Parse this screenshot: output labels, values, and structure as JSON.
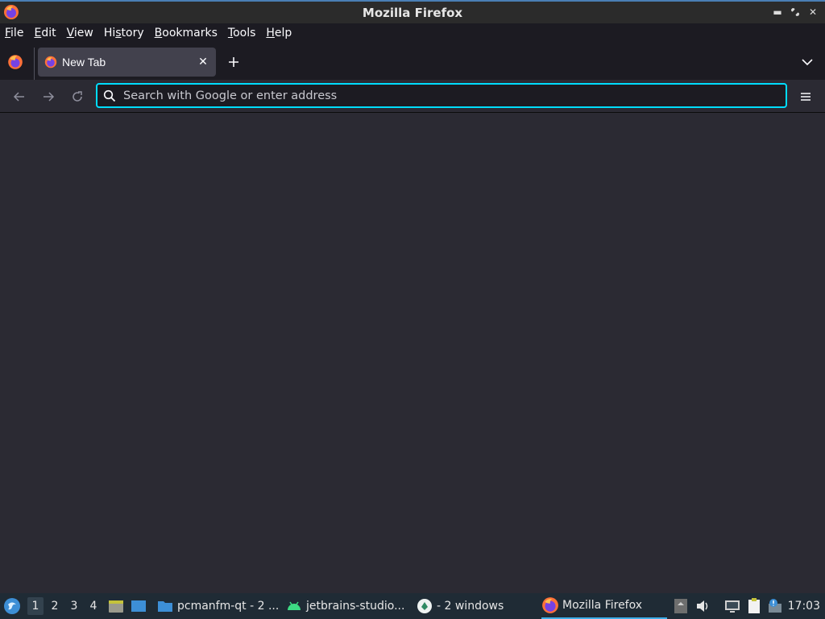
{
  "window": {
    "title": "Mozilla Firefox"
  },
  "menubar": {
    "items": [
      {
        "label": "File",
        "mnemonic": "F",
        "rest": "ile"
      },
      {
        "label": "Edit",
        "mnemonic": "E",
        "rest": "dit"
      },
      {
        "label": "View",
        "mnemonic": "V",
        "rest": "iew"
      },
      {
        "label": "History",
        "mnemonic": "s",
        "pre": "Hi",
        "rest": "tory"
      },
      {
        "label": "Bookmarks",
        "mnemonic": "B",
        "rest": "ookmarks"
      },
      {
        "label": "Tools",
        "mnemonic": "T",
        "rest": "ools"
      },
      {
        "label": "Help",
        "mnemonic": "H",
        "rest": "elp"
      }
    ]
  },
  "tabs": [
    {
      "label": "New Tab",
      "icon": "firefox-icon",
      "active": true
    }
  ],
  "navbar": {
    "back_icon": "back-arrow-icon",
    "forward_icon": "forward-arrow-icon",
    "reload_icon": "reload-icon",
    "menu_icon": "hamburger-menu-icon"
  },
  "urlbar": {
    "value": "",
    "placeholder": "Search with Google or enter address"
  },
  "taskbar": {
    "workspaces": [
      "1",
      "2",
      "3",
      "4"
    ],
    "active_workspace": "1",
    "tasks": [
      {
        "label": "pcmanfm-qt - 2 ...",
        "icon": "folder-icon"
      },
      {
        "label": "jetbrains-studio...",
        "icon": "android-icon"
      },
      {
        "label": "- 2 windows",
        "icon": "android-studio-icon"
      },
      {
        "label": "Mozilla Firefox",
        "icon": "firefox-icon",
        "active": true
      }
    ],
    "clock": "17:03"
  },
  "colors": {
    "accent": "#00ddff",
    "toolbar_bg": "#2b2a33",
    "tabstrip_bg": "#1c1b22",
    "taskbar_bg": "#1f2b35"
  }
}
